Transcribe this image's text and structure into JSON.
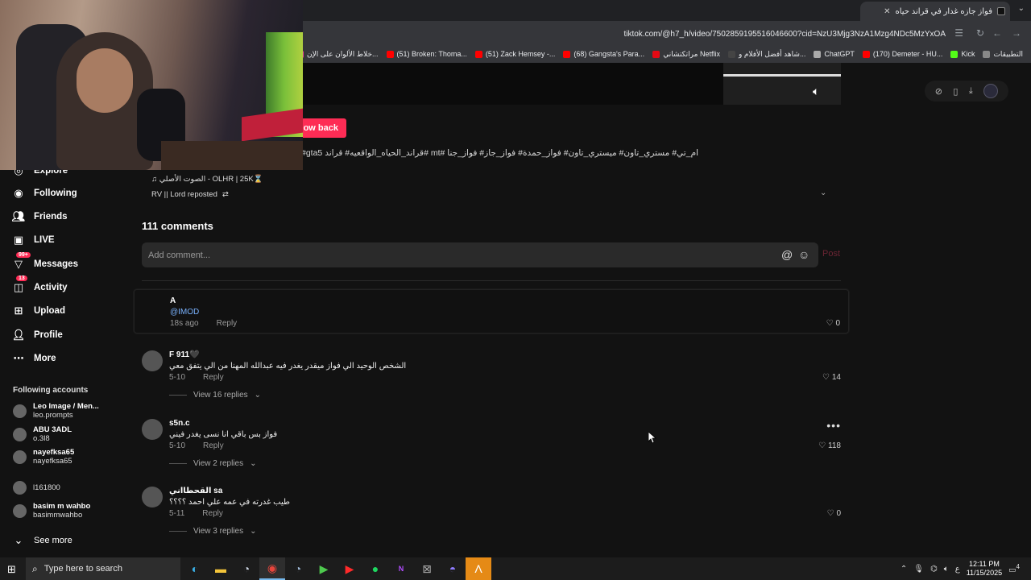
{
  "browser": {
    "tab_title": "فواز جازه غدار في قراند حياه",
    "url": "tiktok.com/@h7_h/video/7502859195516046600?cid=NzU3Mjg3NzA1Mzg4NDc5MzYxOA",
    "bookmarks": [
      {
        "label": "التطبيقات",
        "color": "#888888"
      },
      {
        "label": "Kick",
        "color": "#53fc18"
      },
      {
        "label": "(170) Demeter - HU...",
        "color": "#ff0000"
      },
      {
        "label": "ChatGPT",
        "color": "#aaaaaa"
      },
      {
        "label": "شاهد أفضل الأفلام و...",
        "color": "#444444"
      },
      {
        "label": "مراتكتشاني Netflix",
        "color": "#e50914"
      },
      {
        "label": "(68) Gangsta's Para...",
        "color": "#ff0000"
      },
      {
        "label": "(51) Zack Hemsey -...",
        "color": "#ff0000"
      },
      {
        "label": "(51) Broken: Thoma...",
        "color": "#ff0000"
      },
      {
        "label": "خلاط الألوان على الإن...",
        "color": "#e84393"
      }
    ]
  },
  "video": {
    "follow_back_label": "low back",
    "hashtags": "#gta5 قراند_الحياه_الواقعيه# قراند# mt# ام_تي# مستري_تاون# ميستري_تاون# فواز_حمدة# فواز_جاز# فواز_جنا",
    "sound": "الصوت الأصلي - OLHR | 25K⌛",
    "sound_icon": "♫",
    "repost": "RV || Lord reposted"
  },
  "comments": {
    "title": "111 comments",
    "input_placeholder": "Add comment...",
    "post_label": "Post",
    "reply_label": "Reply",
    "items": [
      {
        "name": "A",
        "text": "@IMOD",
        "time": "18s ago",
        "likes": "0",
        "replies": ""
      },
      {
        "name": "F 911🖤",
        "text": "الشخص الوحيد الي فواز ميقدر يغدر فيه عبدالله المهنا من الي يتفق معي",
        "time": "5-10",
        "likes": "14",
        "replies": "View 16 replies"
      },
      {
        "name": "s5n.c",
        "text": "فواز بس باقي انا نسى يغدر فيني",
        "time": "5-10",
        "likes": "118",
        "replies": "View 2 replies"
      },
      {
        "name": "القحطااني sa",
        "text": "طيب غدرته في عمه علي احمد ؟؟؟؟",
        "time": "5-11",
        "likes": "0",
        "replies": "View 3 replies"
      }
    ]
  },
  "sidebar": {
    "explore": "Explore",
    "following": "Following",
    "friends": "Friends",
    "live": "LIVE",
    "messages": "Messages",
    "messages_badge": "99+",
    "activity": "Activity",
    "activity_badge": "13",
    "upload": "Upload",
    "profile": "Profile",
    "more": "More",
    "following_accounts_title": "Following accounts",
    "accounts": [
      {
        "name": "Leo Image / Men...",
        "handle": "leo.prompts"
      },
      {
        "name": "ABU 3ADL",
        "handle": "o.3l8"
      },
      {
        "name": "nayefksa65",
        "handle": "nayefksa65"
      },
      {
        "name": "",
        "handle": "l161800"
      },
      {
        "name": "basim m wahbo",
        "handle": "basimmwahbo"
      }
    ],
    "see_more": "See more"
  },
  "taskbar": {
    "search_placeholder": "Type here to search",
    "time": "12:11 PM",
    "date": "11/15/2025",
    "lang": "ع",
    "notif_count": "4"
  }
}
